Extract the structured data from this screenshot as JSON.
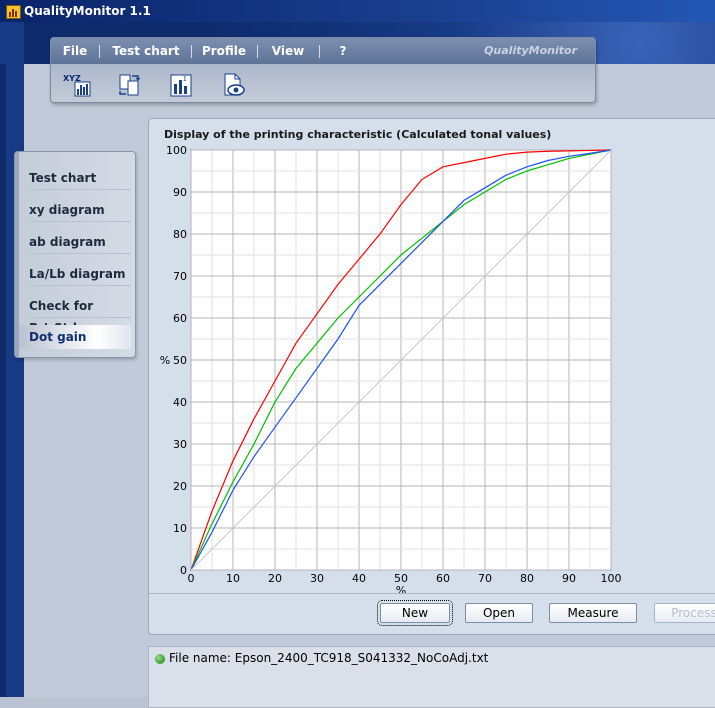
{
  "window": {
    "title": "QualityMonitor 1.1"
  },
  "menu": {
    "items": [
      "File",
      "Test chart",
      "Profile",
      "View",
      "?"
    ],
    "brand": "QualityMonitor"
  },
  "toolbar": {
    "icons": [
      "xyz-chart-icon",
      "convert-icon",
      "bar-chart-icon",
      "document-view-icon"
    ],
    "xyz_label": "XYZ"
  },
  "sidenav": {
    "items": [
      "Test chart",
      "xy diagram",
      "ab diagram",
      "La/Lb diagram",
      "Check for Prt.Std.",
      "Dot gain"
    ],
    "active": "Dot gain"
  },
  "panel": {
    "title": "Display of the printing characteristic (Calculated tonal values)",
    "buttons": {
      "new": "New",
      "open": "Open",
      "measure": "Measure",
      "process": "Process"
    }
  },
  "status": {
    "file_label": "File name: Epson_2400_TC918_S041332_NoCoAdj.txt"
  },
  "colors": {
    "red": "#ff0000",
    "green": "#00c000",
    "blue": "#2050ff",
    "reference": "#c8c8c8"
  },
  "chart_data": {
    "type": "line",
    "title": "",
    "xlabel": "%",
    "ylabel": "%",
    "xlim": [
      0,
      100
    ],
    "ylim": [
      0,
      100
    ],
    "xticks": [
      0,
      10,
      20,
      30,
      40,
      50,
      60,
      70,
      80,
      90,
      100
    ],
    "yticks": [
      0,
      10,
      20,
      30,
      40,
      50,
      60,
      70,
      80,
      90,
      100
    ],
    "grid": true,
    "series": [
      {
        "color": "#ff0000",
        "x": [
          0,
          5,
          10,
          15,
          20,
          25,
          30,
          35,
          40,
          45,
          50,
          55,
          60,
          65,
          70,
          75,
          80,
          85,
          90,
          95,
          100
        ],
        "y": [
          0,
          14,
          26,
          36,
          45,
          54,
          61,
          68,
          74,
          80,
          87,
          93,
          96,
          97,
          98,
          99,
          99.5,
          99.7,
          99.8,
          99.9,
          100
        ]
      },
      {
        "color": "#00c000",
        "x": [
          0,
          5,
          10,
          15,
          20,
          25,
          30,
          35,
          40,
          45,
          50,
          55,
          60,
          65,
          70,
          75,
          80,
          85,
          90,
          95,
          100
        ],
        "y": [
          0,
          11,
          21,
          30,
          40,
          48,
          54,
          60,
          65,
          70,
          75,
          79,
          83,
          87,
          90,
          93,
          95,
          96.5,
          98,
          99,
          100
        ]
      },
      {
        "color": "#2050ff",
        "x": [
          0,
          5,
          10,
          15,
          20,
          25,
          30,
          35,
          40,
          45,
          50,
          55,
          60,
          65,
          70,
          75,
          80,
          85,
          90,
          95,
          100
        ],
        "y": [
          0,
          9,
          19,
          27,
          34,
          41,
          48,
          55,
          63,
          68,
          73,
          78,
          83,
          88,
          91,
          94,
          96,
          97.5,
          98.5,
          99.2,
          100
        ]
      },
      {
        "color": "#c8c8c8",
        "x": [
          0,
          100
        ],
        "y": [
          0,
          100
        ]
      }
    ]
  }
}
